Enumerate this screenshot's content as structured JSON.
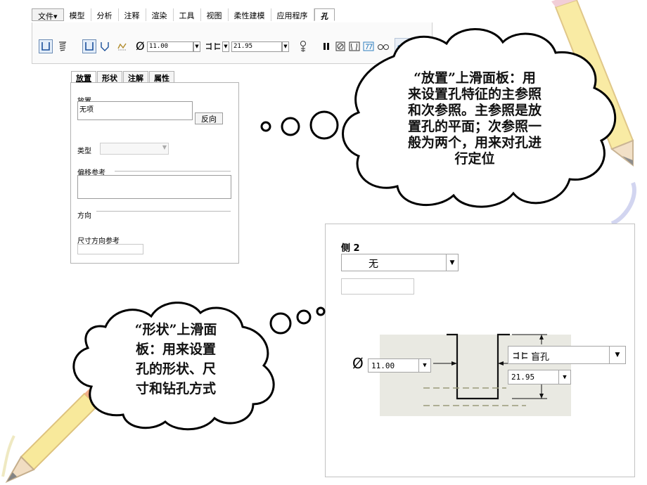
{
  "menubar": {
    "items": [
      "文件▾",
      "模型",
      "分析",
      "注释",
      "渲染",
      "工具",
      "视图",
      "柔性建模",
      "应用程序",
      "孔"
    ]
  },
  "ribbon": {
    "diameter_value": "11.00",
    "depth_value": "21.95"
  },
  "subtabs": [
    "放置",
    "形状",
    "注解",
    "属性"
  ],
  "placement": {
    "section_label": "放置",
    "field_value": "无项",
    "reverse_button": "反向",
    "type_label": "类型",
    "offset_label": "偏移参考",
    "direction_label": "方向",
    "dim_ref_label": "尺寸方向参考"
  },
  "shape": {
    "side_label": "侧 2",
    "side_value": "无",
    "diameter_symbol": "Ø",
    "diameter_value": "11.00",
    "depth_symbol": "ꟷ⫫ꟷ",
    "depth_type": "盲孔",
    "depth_value": "21.95"
  },
  "callouts": {
    "placement_lines": [
      "“放置”上滑面板：用",
      "来设置孔特征的主参照",
      "和次参照。主参照是放",
      "置孔的平面；次参照一",
      "般为两个，用来对孔进",
      "行定位"
    ],
    "shape_lines": [
      "“形状”上滑面",
      "板：用来设置",
      "孔的形状、尺",
      "寸和钻孔方式"
    ]
  },
  "colors": {
    "ok_check": "#2f7fbf",
    "cancel_x": "#c0141c",
    "pencil_yellow": "#f5dc5a",
    "pencil_blue": "#5b66c9"
  }
}
